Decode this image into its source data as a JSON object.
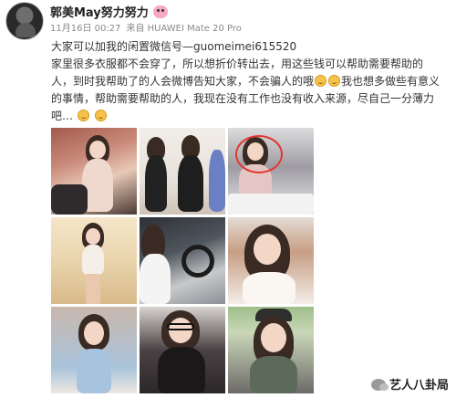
{
  "post": {
    "username": "郭美May努力努力",
    "date": "11月16日 00:27",
    "source": "来自 HUAWEI Mate 20 Pro",
    "lines": [
      "大家可以加我的闲置微信号—guomeimei615520",
      "家里很多衣服都不会穿了，所以想折价转出去，用这些钱可以帮助需要帮助的",
      "人，到时我帮助了的人会微博告知大家，不会骗人的哦",
      "我也想多做些有意义",
      "的事情，帮助需要帮助的人，我现在没有工作也没有收入来源，尽自己一分薄力",
      "吧…"
    ],
    "photos_count": 9
  },
  "watermark": {
    "label": "艺人八卦局"
  },
  "icons": {
    "level": "level-badge-icon",
    "emoji": "grin-emoji-icon",
    "wechat": "wechat-icon"
  },
  "colors": {
    "highlight_circle": "#e3372f",
    "meta_text": "#8a8a8a"
  }
}
